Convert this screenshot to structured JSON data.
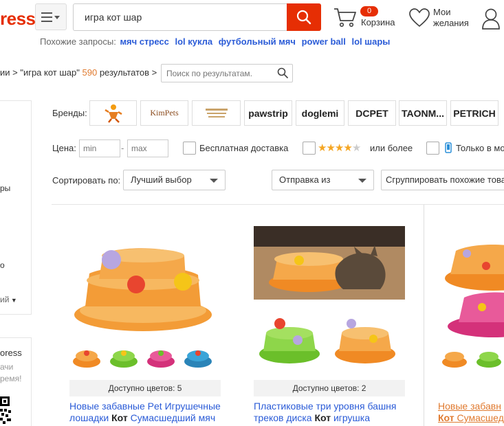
{
  "header": {
    "logo_text": "ress",
    "logo_tm": "™",
    "search_value": "игра кот шар",
    "cart_count": "0",
    "cart_label": "Корзина",
    "wishlist_label": "Мои желания"
  },
  "related": {
    "label": "Похожие запросы:",
    "items": [
      "мяч стресс",
      "lol кукла",
      "футбольный мяч",
      "power ball",
      "lol шары"
    ]
  },
  "breadcrumb": {
    "prefix": "ии > \"игра кот шар\" ",
    "count": "590",
    "suffix": " результатов >",
    "sub_search_placeholder": "Поиск по результатам."
  },
  "left_panel": {
    "items": [
      "ры",
      "о",
      "ий"
    ],
    "promo_lines": [
      "oress",
      "ачи",
      "ремя!"
    ]
  },
  "filters": {
    "brands_label": "Бренды:",
    "brands": [
      "",
      "KimPets",
      "",
      "pawstrip",
      "doglemi",
      "DCPET",
      "TAONM...",
      "PETRICH"
    ],
    "price_label": "Цена:",
    "price_min_placeholder": "min",
    "price_dash": "-",
    "price_max_placeholder": "max",
    "free_shipping": "Бесплатная доставка",
    "rating_suffix": "или более",
    "rating_stars": 4,
    "only_mobile": "Только в мо",
    "sort_label": "Сортировать по:",
    "sort_value": "Лучший выбор",
    "ship_from": "Отправка из",
    "group_similar": "Сгруппировать похожие това"
  },
  "products": [
    {
      "colors": "Доступно цветов: 5",
      "title_parts": [
        "Новые забавные Pet Игрушечные лошадки ",
        "Кот",
        " Сумасшедший мяч"
      ]
    },
    {
      "colors": "Доступно цветов: 2",
      "title_parts": [
        "Пластиковые три уровня башня треков диска ",
        "Кот",
        " игрушка"
      ]
    },
    {
      "colors": "",
      "title_parts": [
        "Новые забавн",
        "Кот",
        " Сумасшед"
      ]
    }
  ],
  "colors": {
    "accent": "#e62e04",
    "link": "#2a5bd7",
    "star": "#f5a623",
    "count": "#e07a2f"
  }
}
